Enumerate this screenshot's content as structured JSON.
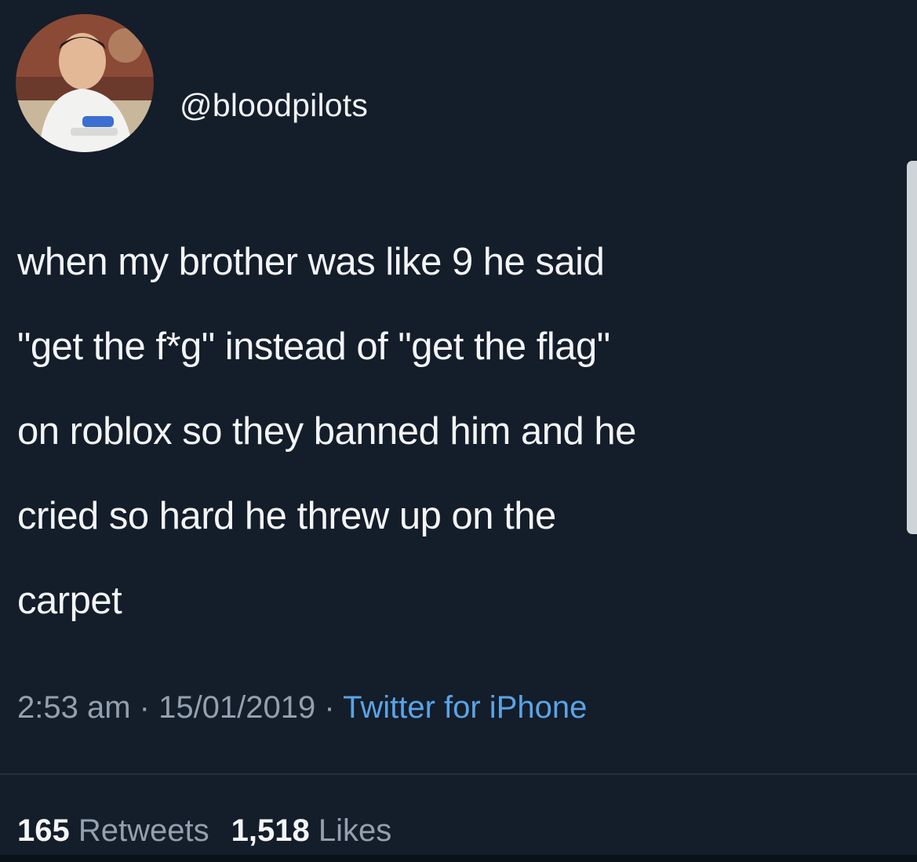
{
  "tweet": {
    "handle": "@bloodpilots",
    "lines": [
      "when my brother was like 9 he said",
      "\"get the f*g\" instead of \"get the flag\"",
      "on roblox so they banned him and he",
      "cried so hard he threw up on the",
      "carpet"
    ],
    "time": "2:53 am",
    "separator": " · ",
    "date": "15/01/2019",
    "source": "Twitter for iPhone",
    "retweets_count": "165",
    "retweets_label": "Retweets",
    "likes_count": "1,518",
    "likes_label": "Likes"
  },
  "colors": {
    "background": "#141d2a",
    "text": "#f3f4f6",
    "muted": "#93a0ad",
    "link": "#5aa4e6"
  }
}
